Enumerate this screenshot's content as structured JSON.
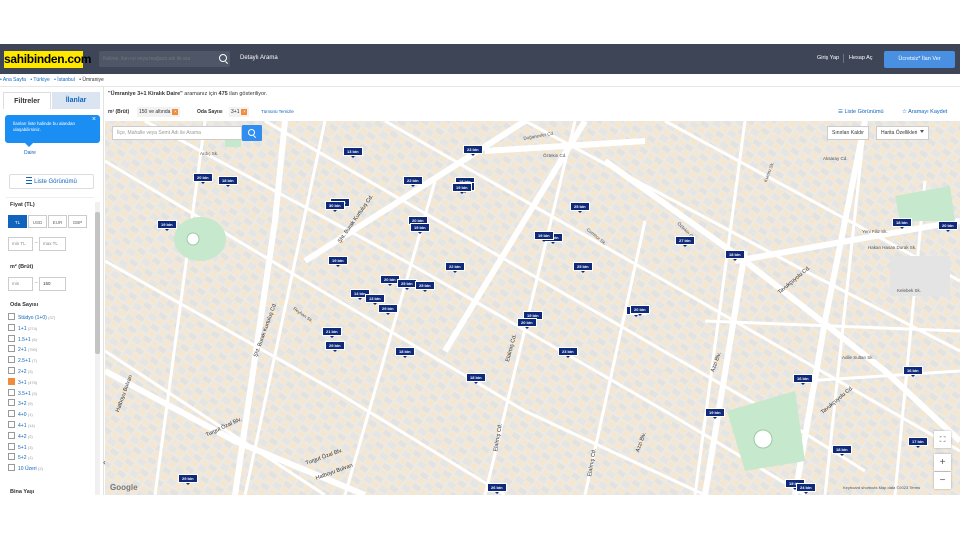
{
  "header": {
    "logo": "sahibinden.com",
    "search_placeholder": "Kelime, ilan no veya mağaza adı ile ara",
    "detailed_search": "Detaylı Arama",
    "login": "Giriş Yap",
    "register": "Hesap Aç",
    "post_ad": "Ücretsiz* İlan Ver"
  },
  "breadcrumb": [
    "• Ana Sayfa",
    "• Türkiye",
    "• İstanbul",
    "• Ümraniye"
  ],
  "sidebar": {
    "tab_filters": "Filtreler",
    "tab_listings": "İlanlar",
    "tip": "İlanları liste halinde bu alandan ulaşabilirsiniz.",
    "category": "Daire",
    "list_view_btn": "Liste Görünümü",
    "price_label": "Fiyat (TL)",
    "currencies": [
      "TL",
      "USD",
      "EUR",
      "GBP"
    ],
    "min_tl": "min TL",
    "max_tl": "max TL",
    "area_label": "m² (Brüt)",
    "min_area": "min",
    "max_area": "150",
    "rooms_label": "Oda Sayısı",
    "rooms": [
      {
        "label": "Stüdyo (1+0)",
        "count": "(37)",
        "checked": false
      },
      {
        "label": "1+1",
        "count": "(274)",
        "checked": false
      },
      {
        "label": "1.5+1",
        "count": "(6)",
        "checked": false
      },
      {
        "label": "2+1",
        "count": "(790)",
        "checked": false
      },
      {
        "label": "2.5+1",
        "count": "(7)",
        "checked": false
      },
      {
        "label": "2+2",
        "count": "(3)",
        "checked": false
      },
      {
        "label": "3+1",
        "count": "(475)",
        "checked": true
      },
      {
        "label": "3.5+1",
        "count": "(3)",
        "checked": false
      },
      {
        "label": "3+2",
        "count": "(9)",
        "checked": false
      },
      {
        "label": "4+0",
        "count": "(1)",
        "checked": false
      },
      {
        "label": "4+1",
        "count": "(14)",
        "checked": false
      },
      {
        "label": "4+2",
        "count": "(2)",
        "checked": false
      },
      {
        "label": "5+1",
        "count": "(3)",
        "checked": false
      },
      {
        "label": "5+2",
        "count": "(1)",
        "checked": false
      },
      {
        "label": "10 Üzeri",
        "count": "(2)",
        "checked": false
      }
    ],
    "building_age_label": "Bina Yaşı"
  },
  "summary": {
    "query": "\"Ümraniye 3+1 Kiralık Daire\"",
    "middle": " aramanız için ",
    "count": "475",
    "tail": " ilan gösteriliyor."
  },
  "filters": {
    "area_label": "m² (Brüt)",
    "area_value": "150 ve altında",
    "room_label": "Oda Sayısı",
    "room_value": "3+1",
    "clear_all": "Tümünü Temizle",
    "list_view": "Liste Görünümü",
    "save_search": "Aramayı Kaydet"
  },
  "map": {
    "search_placeholder": "İlçe, Mahalle veya Semt Adı ile Arama",
    "remove_bounds": "Sınırları Kaldır",
    "map_features": "Harita Özellikleri",
    "zoom_in": "+",
    "zoom_out": "−",
    "attribution": "Keyboard shortcuts   Map data ©2023   Terms",
    "google": "Google",
    "pins": [
      {
        "t": "13 bin"
      },
      {
        "t": "23 bin"
      },
      {
        "t": "20 bin"
      },
      {
        "t": "18 bin"
      },
      {
        "t": "22 bin"
      },
      {
        "t": "18 bin"
      },
      {
        "t": "18 bin"
      },
      {
        "t": "20 bin"
      },
      {
        "t": "30 bin"
      },
      {
        "t": "25 bin"
      },
      {
        "t": "20 bin"
      },
      {
        "t": "19 bin"
      },
      {
        "t": "19 bin"
      },
      {
        "t": "27 bin"
      },
      {
        "t": "27 bin"
      },
      {
        "t": "18 bin"
      },
      {
        "t": "18 bin"
      },
      {
        "t": "20 bin"
      },
      {
        "t": "19 bin"
      },
      {
        "t": "22 bin"
      },
      {
        "t": "25 bin"
      },
      {
        "t": "20 bin"
      },
      {
        "t": "25 bin"
      },
      {
        "t": "25 bin"
      },
      {
        "t": "14 bin"
      },
      {
        "t": "13 bin"
      },
      {
        "t": "29 bin"
      },
      {
        "t": "19 bin"
      },
      {
        "t": "20 bin"
      },
      {
        "t": "21 bin"
      },
      {
        "t": "29 bin"
      },
      {
        "t": "28 bin"
      },
      {
        "t": "18 bin"
      },
      {
        "t": "23 bin"
      },
      {
        "t": "20 bin"
      },
      {
        "t": "18 bin"
      },
      {
        "t": "16 bin"
      },
      {
        "t": "16 bin"
      },
      {
        "t": "19 bin"
      },
      {
        "t": "17 bin"
      },
      {
        "t": "18 bin"
      },
      {
        "t": "15 bin"
      },
      {
        "t": "29 bin"
      },
      {
        "t": "26 bin"
      },
      {
        "t": "19 bin"
      },
      {
        "t": "24 bin"
      },
      {
        "t": "19 bin"
      }
    ],
    "streets": [
      "Doğanevler Cd.",
      "Öztekin Cd.",
      "Şht. Burak Kurtuluş Cd.",
      "Şht. Burak Kurtuluş Cd.",
      "Hatboyu Bulvarı",
      "Turgut Özal Blv.",
      "Turgut Özal Blv.",
      "Hatboyu Bulvarı",
      "Elalmış Cd.",
      "Elalmış Cd.",
      "Elalmış Cd.",
      "Öztekin Cd.",
      "Tavukçuyolu Cd.",
      "Tavukçuyolu Cd.",
      "Azzi Blv.",
      "Azzi Blv.",
      "Reyhan Sk.",
      "Kumru Sk.",
      "Aksaray Cd.",
      "Hakan Hasan Durak Sk.",
      "Yeni Filiz Sk.",
      "Adile Sultan Sk.",
      "Cumhur Sk.",
      "Kelebek Sk.",
      "Ardıç Sk."
    ]
  }
}
